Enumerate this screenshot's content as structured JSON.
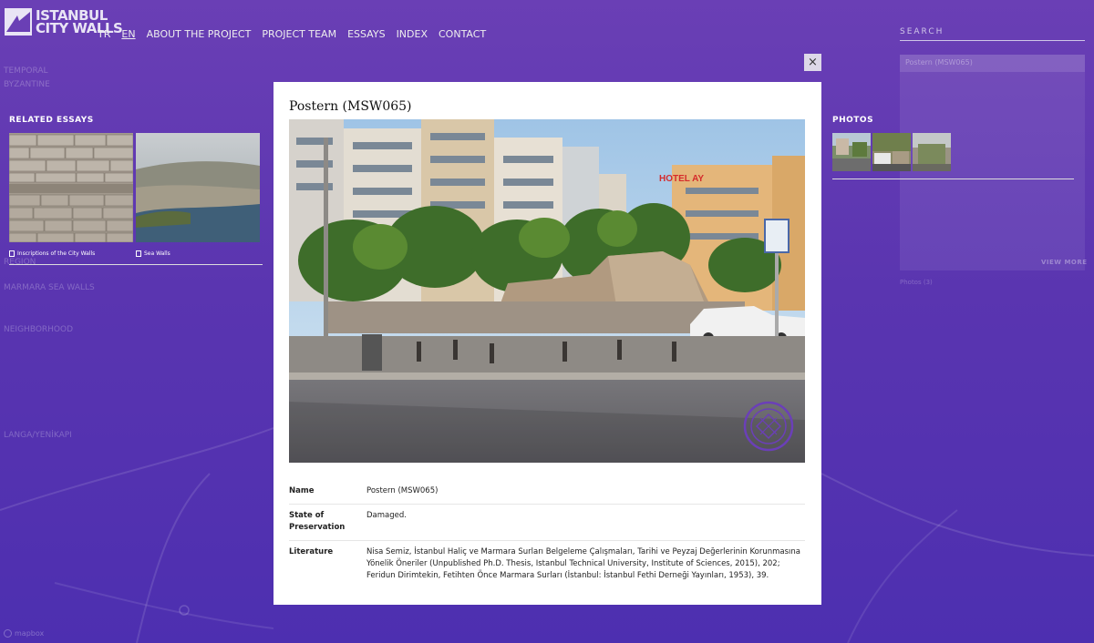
{
  "logo": {
    "line1": "ISTANBUL",
    "line2": "CITY WALLS"
  },
  "nav": [
    {
      "label": "TR",
      "active": false
    },
    {
      "label": "EN",
      "active": true
    },
    {
      "label": "ABOUT THE PROJECT",
      "active": false
    },
    {
      "label": "PROJECT TEAM",
      "active": false
    },
    {
      "label": "ESSAYS",
      "active": false
    },
    {
      "label": "INDEX",
      "active": false
    },
    {
      "label": "CONTACT",
      "active": false
    }
  ],
  "search": {
    "label": "SEARCH"
  },
  "background_left": {
    "period_label": "TEMPORAL",
    "period_value": "BYZANTINE",
    "region_label": "REGION",
    "region_value": "MARMARA SEA WALLS",
    "neighborhood_label": "NEIGHBORHOOD",
    "neighborhood_value": "LANGA/YENİKAPI"
  },
  "related_essays": {
    "title": "RELATED ESSAYS",
    "items": [
      {
        "label": "Inscriptions of the City Walls"
      },
      {
        "label": "Sea Walls"
      }
    ]
  },
  "photos": {
    "title": "PHOTOS"
  },
  "side_panel": {
    "field_value": "Postern (MSW065)",
    "view_more": "VIEW MORE",
    "photos_count": "Photos (3)"
  },
  "modal": {
    "close_symbol": "×",
    "title": "Postern (MSW065)",
    "photo_sign": "HOTEL AY",
    "rows": [
      {
        "key": "Name",
        "value": "Postern (MSW065)"
      },
      {
        "key": "State of Preservation",
        "value": "Damaged."
      },
      {
        "key": "Literature",
        "value": "Nisa Semiz, İstanbul Haliç ve Marmara Surları Belgeleme Çalışmaları, Tarihi ve Peyzaj Değerlerinin Korunmasına Yönelik Öneriler (Unpublished Ph.D. Thesis, Istanbul Technical University, Institute of Sciences, 2015), 202; Feridun Dirimtekin, Fetihten Önce Marmara Surları (İstanbul: İstanbul Fethi Derneği Yayınları, 1953), 39."
      }
    ]
  },
  "map_credit": "mapbox",
  "colors": {
    "background": "#5a35b0",
    "modal": "#ffffff",
    "seal": "#6b3fb8"
  }
}
